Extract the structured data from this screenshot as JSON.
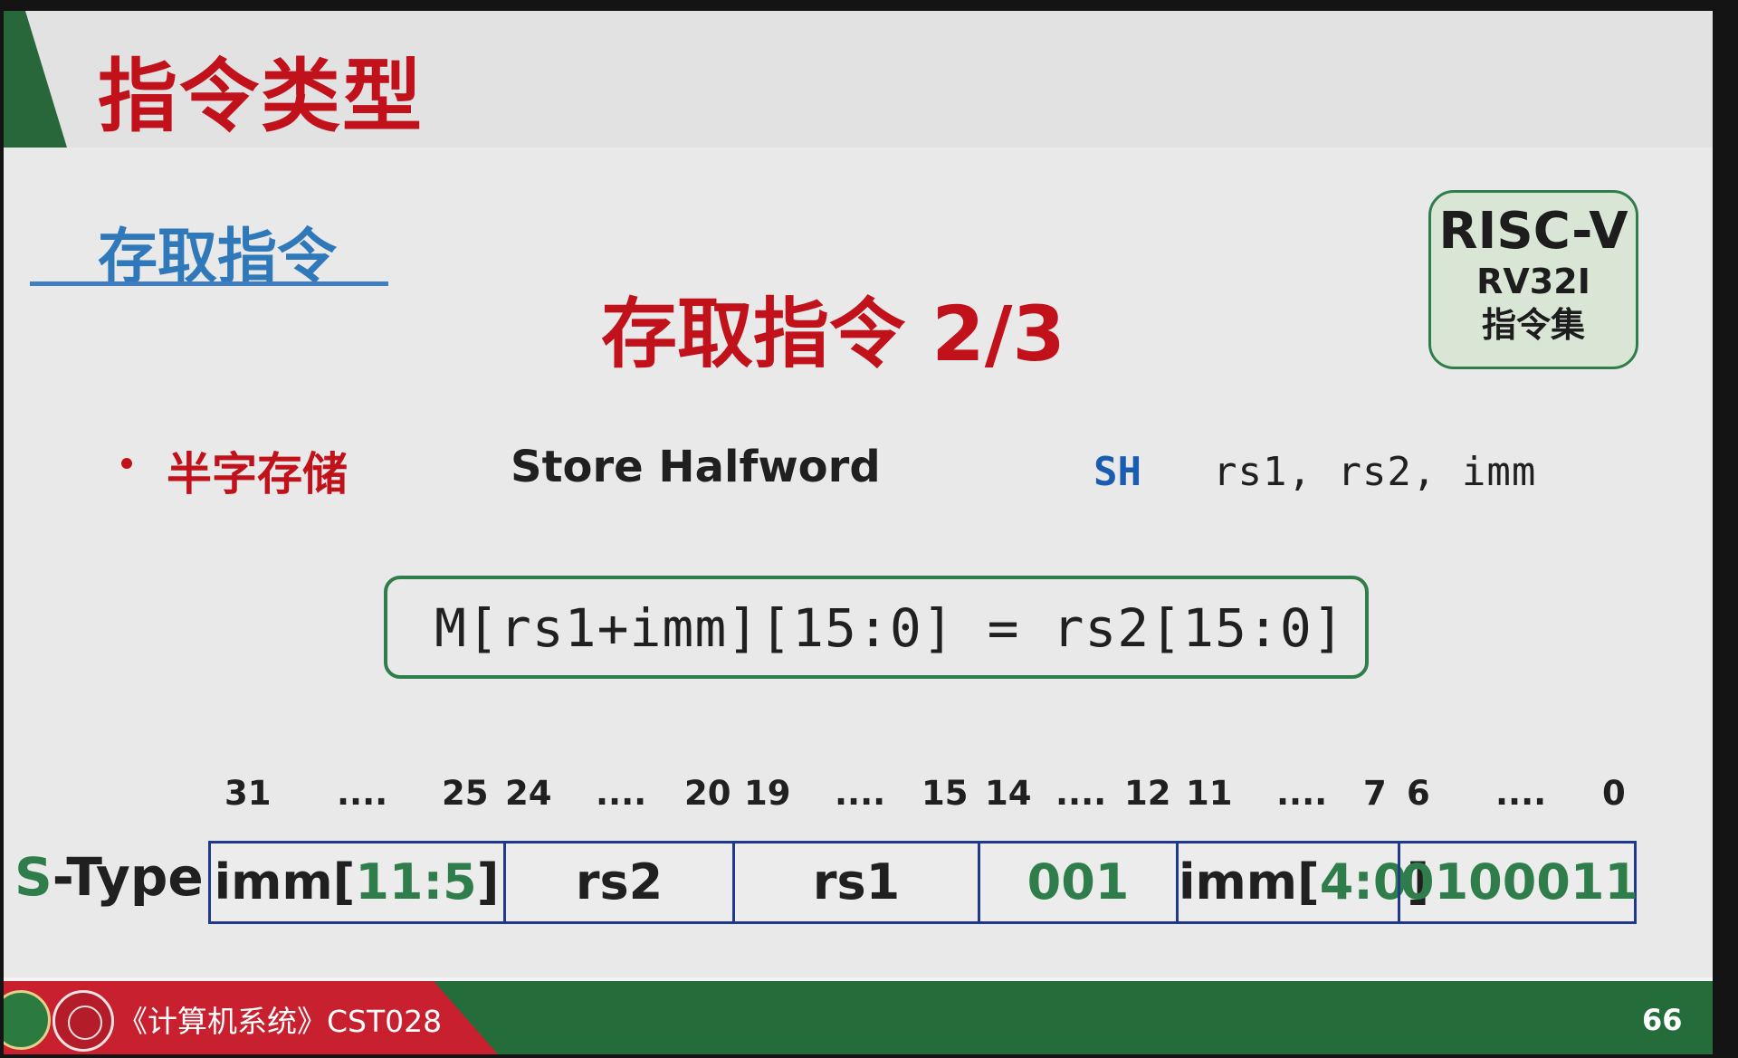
{
  "header": {
    "title": "指令类型"
  },
  "section": {
    "title": "存取指令"
  },
  "main": {
    "title": "存取指令 2/3"
  },
  "badge": {
    "line1": "RISC-V",
    "line2": "RV32I",
    "line3": "指令集"
  },
  "instruction": {
    "cn_name": "半字存储",
    "en_name": "Store Halfword",
    "opcode": "SH",
    "operands": "rs1, rs2, imm",
    "semantics": "M[rs1+imm][15:0] = rs2[15:0]"
  },
  "encoding": {
    "format_prefix": "S",
    "format_suffix": "-Type",
    "bit_labels": [
      "31",
      "....",
      "25",
      "24",
      "....",
      "20",
      "19",
      "....",
      "15",
      "14",
      "....",
      "12",
      "11",
      "....",
      "7",
      "6",
      "....",
      "0"
    ],
    "fields": [
      {
        "label_main": "imm[",
        "label_bits": "11:5",
        "label_end": "]"
      },
      {
        "label": "rs2"
      },
      {
        "label": "rs1"
      },
      {
        "label": "001"
      },
      {
        "label_main": "imm[",
        "label_bits": "4:0",
        "label_end": "]"
      },
      {
        "label": "0100011"
      }
    ]
  },
  "footer": {
    "course": "《计算机系统》CST028",
    "page": "66"
  },
  "colors": {
    "title_red": "#c1121c",
    "section_blue": "#2f78b9",
    "accent_green": "#2f7d4a",
    "field_border": "#1f3a8a"
  }
}
